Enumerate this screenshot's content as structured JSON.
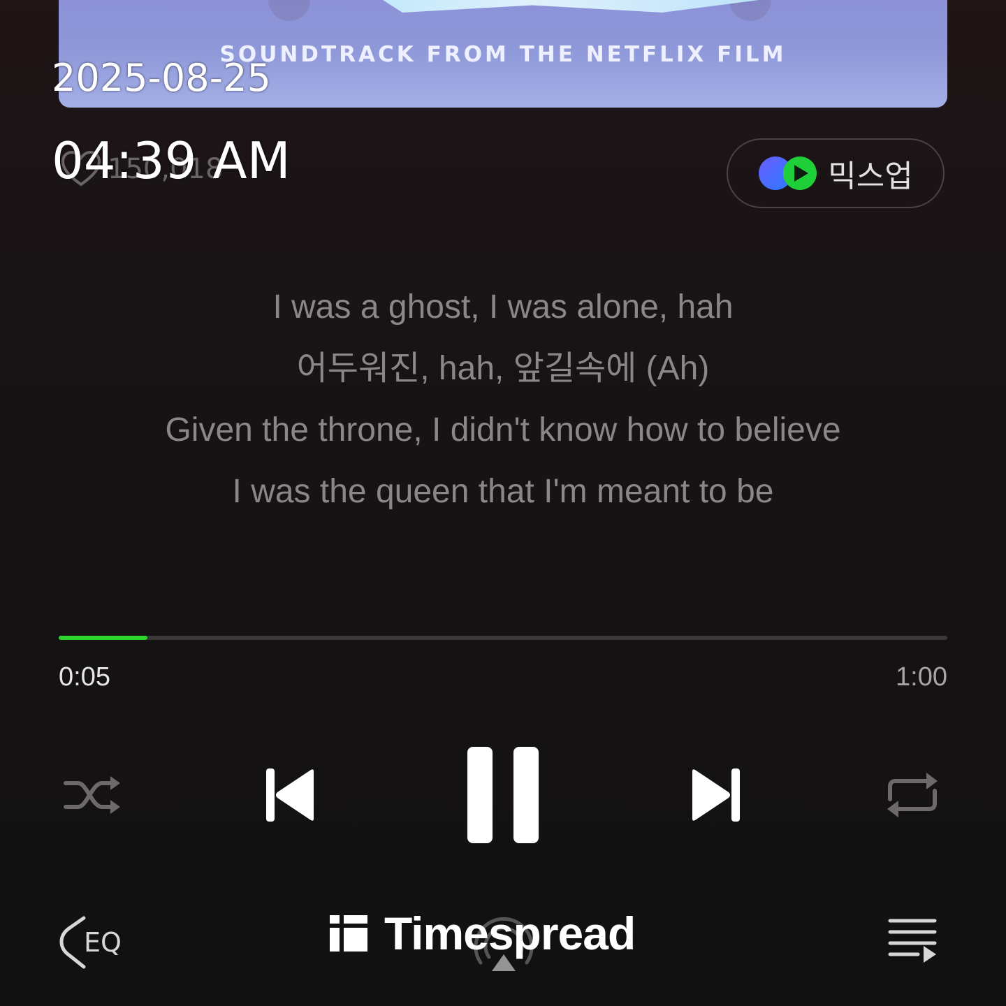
{
  "album": {
    "subtitle": "SOUNDTRACK FROM THE NETFLIX FILM"
  },
  "overlay": {
    "date": "2025-08-25",
    "time": "04:39 AM"
  },
  "like": {
    "count": "150,018",
    "icon": "heart-outline-icon"
  },
  "mixup": {
    "label": "믹스업",
    "icon": "mixup-logo-icon"
  },
  "lyrics": [
    "I was a ghost, I was alone, hah",
    "어두워진, hah, 앞길속에 (Ah)",
    "Given the throne, I didn't know how to believe",
    "I was the queen that I'm meant to be"
  ],
  "playback": {
    "elapsed": "0:05",
    "total": "1:00",
    "progress_fraction": 0.1,
    "accent_color": "#2ed52e"
  },
  "controls": {
    "shuffle": "shuffle-icon",
    "previous": "skip-previous-icon",
    "pause": "pause-icon",
    "next": "skip-next-icon",
    "repeat": "repeat-icon"
  },
  "bottom": {
    "eq_label": "EQ",
    "watermark": "Timespread",
    "playlist": "playlist-icon",
    "cast": "cast-icon"
  }
}
